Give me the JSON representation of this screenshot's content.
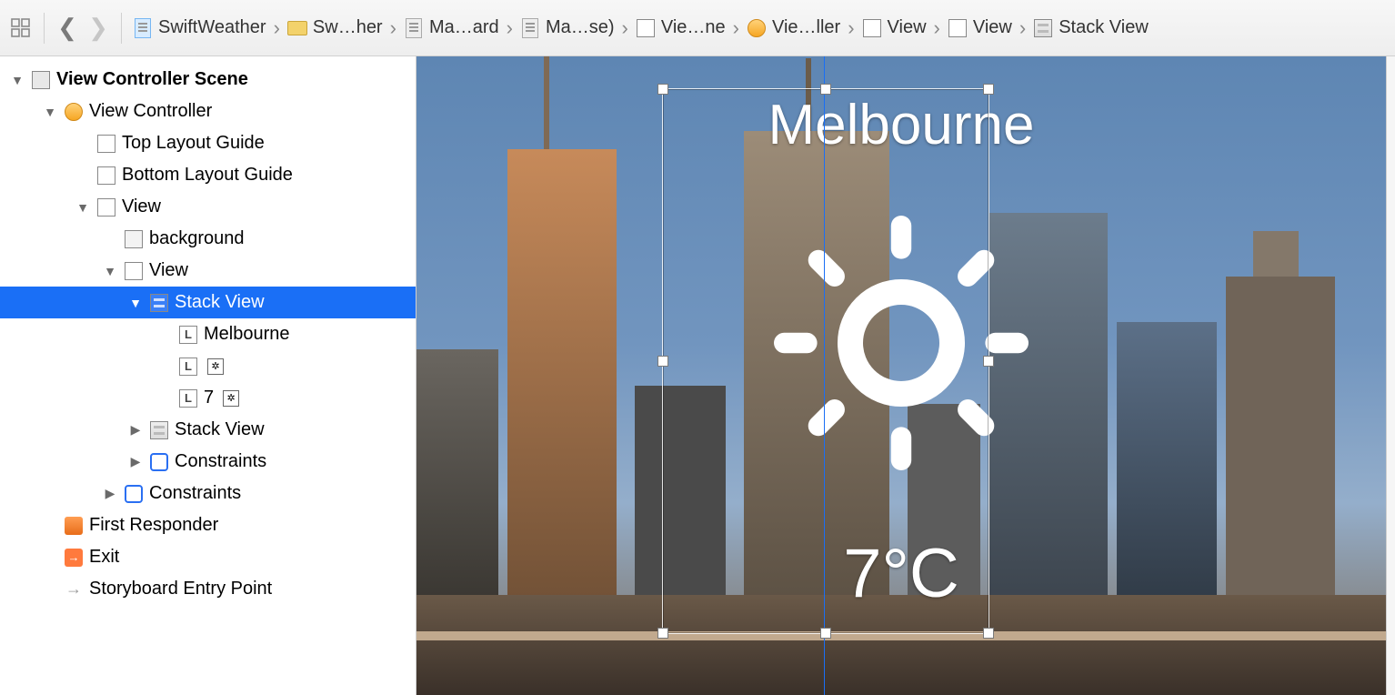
{
  "breadcrumb": {
    "project": "SwiftWeather",
    "items": [
      "Sw…her",
      "Ma…ard",
      "Ma…se)",
      "Vie…ne",
      "Vie…ller",
      "View",
      "View",
      "Stack View"
    ]
  },
  "outline": {
    "scene": "View Controller Scene",
    "vc": "View Controller",
    "topGuide": "Top Layout Guide",
    "bottomGuide": "Bottom Layout Guide",
    "view1": "View",
    "background": "background",
    "view2": "View",
    "stack1": "Stack View",
    "melbourne": "Melbourne",
    "blank": "",
    "seven": "7",
    "stack2": "Stack View",
    "constraints1": "Constraints",
    "constraints2": "Constraints",
    "firstResponder": "First Responder",
    "exit": "Exit",
    "entry": "Storyboard Entry Point"
  },
  "canvas": {
    "city": "Melbourne",
    "temp": "7°C"
  }
}
